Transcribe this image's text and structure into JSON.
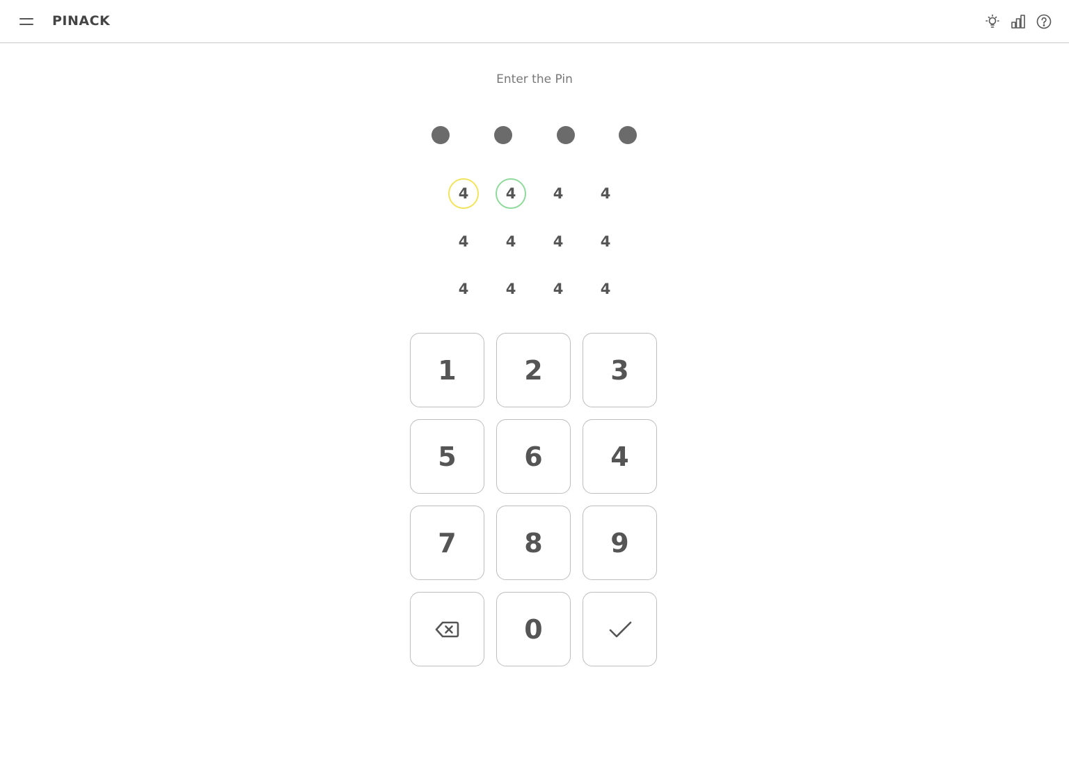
{
  "header": {
    "title": "PINACK",
    "icons": [
      "menu-icon",
      "lightbulb-icon",
      "bar-chart-icon",
      "help-icon"
    ]
  },
  "prompt": "Enter the Pin",
  "pin_dots_filled": 4,
  "number_grid": [
    [
      "4",
      "4",
      "4",
      "4"
    ],
    [
      "4",
      "4",
      "4",
      "4"
    ],
    [
      "4",
      "4",
      "4",
      "4"
    ]
  ],
  "grid_highlights": {
    "yellow": [
      0,
      0
    ],
    "green": [
      0,
      1
    ]
  },
  "colors": {
    "highlight_yellow": "#f2e35c",
    "highlight_green": "#8fd99b",
    "dot": "#6b6b6b"
  },
  "keypad": {
    "rows": [
      [
        "1",
        "2",
        "3"
      ],
      [
        "5",
        "6",
        "4"
      ],
      [
        "7",
        "8",
        "9"
      ]
    ],
    "zero": "0",
    "backspace_icon": "backspace-icon",
    "confirm_icon": "check-icon"
  }
}
